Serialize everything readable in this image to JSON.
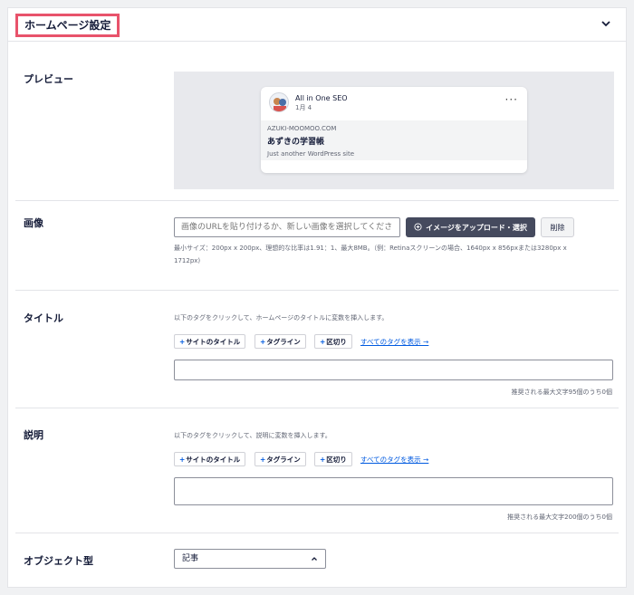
{
  "header": {
    "title": "ホームページ設定"
  },
  "preview": {
    "label": "プレビュー",
    "card": {
      "site_name": "All in One SEO",
      "date": "1月 4",
      "more": "···",
      "domain": "AZUKI-MOOMOO.COM",
      "title": "あずきの学習帳",
      "description": "Just another WordPress site"
    }
  },
  "image": {
    "label": "画像",
    "url_placeholder": "画像のURLを貼り付けるか、新しい画像を選択してください",
    "upload_label": "イメージをアップロード・選択",
    "delete_label": "削除",
    "help_line1": "最小サイズ：200px x 200px、理想的な比率は1.91：1、最大8MB。（例：Retinaスクリーンの場合、1640px x 856pxまたは3280px x",
    "help_line2": "1712px)"
  },
  "title_section": {
    "label": "タイトル",
    "help": "以下のタグをクリックして、ホームページのタイトルに変数を挿入します。",
    "tags": [
      "サイトのタイトル",
      "タグライン",
      "区切り"
    ],
    "all_tags": "すべてのタグを表示 →",
    "counter": "推奨される最大文字95個のうち0個"
  },
  "description_section": {
    "label": "説明",
    "help": "以下のタグをクリックして、説明に変数を挿入します。",
    "tags": [
      "サイトのタイトル",
      "タグライン",
      "区切り"
    ],
    "all_tags": "すべてのタグを表示 →",
    "counter": "推奨される最大文字200個のうち0個"
  },
  "object_type": {
    "label": "オブジェクト型",
    "selected": "記事"
  }
}
